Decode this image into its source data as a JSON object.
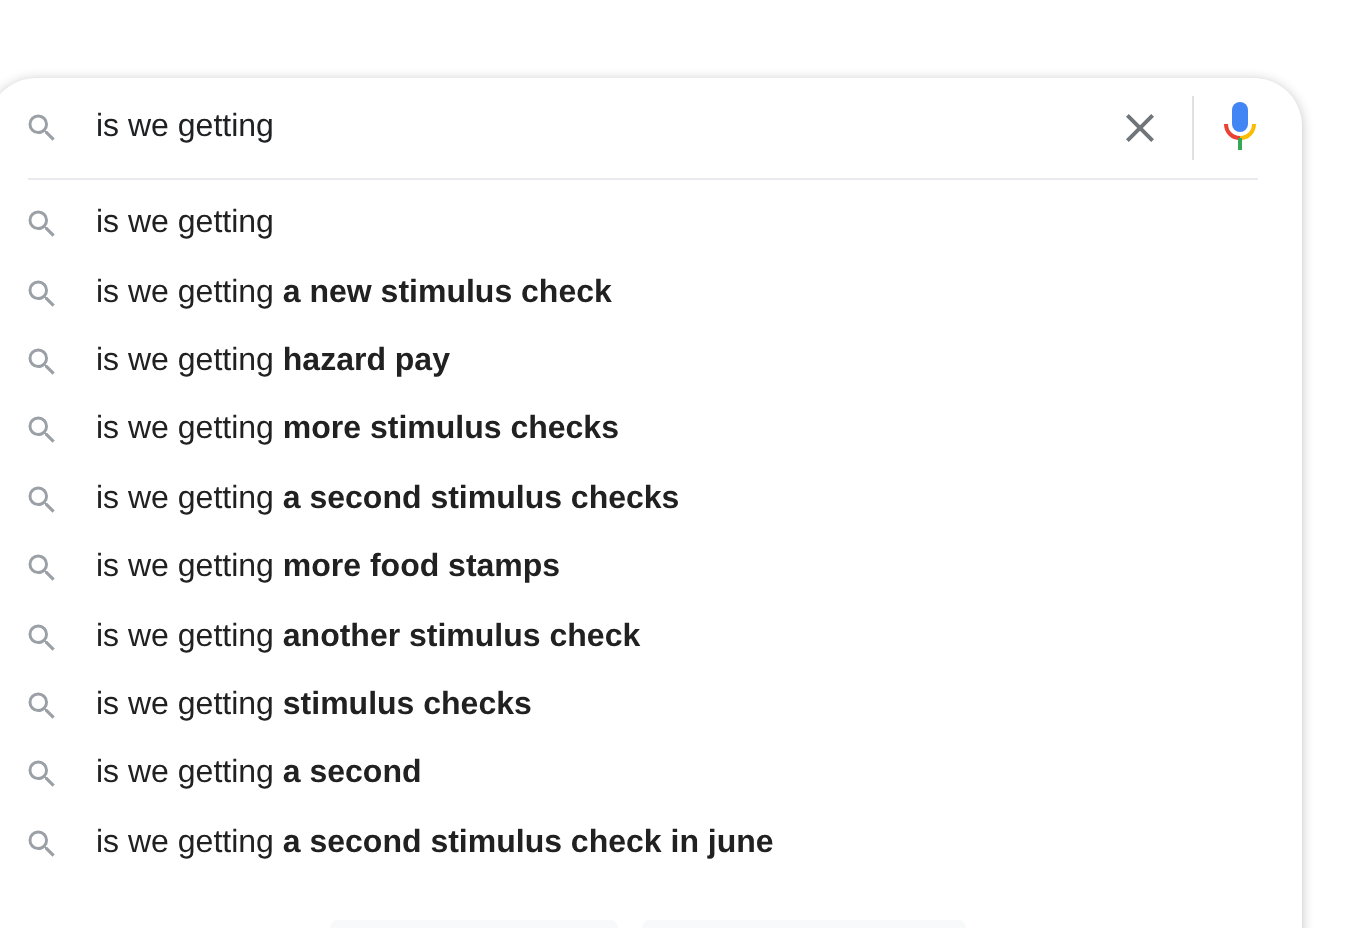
{
  "search": {
    "value": "is we getting"
  },
  "suggestions": [
    {
      "text": "is we getting"
    },
    {
      "text": "is we getting **a new stimulus check**"
    },
    {
      "text": "is we getting **hazard pay**"
    },
    {
      "text": "is we getting **more stimulus checks**"
    },
    {
      "text": "is we getting **a second stimulus checks**"
    },
    {
      "text": "is we getting **more food stamps**"
    },
    {
      "text": "is we getting **another stimulus check**"
    },
    {
      "text": "is we getting **stimulus checks**"
    },
    {
      "text": "is we getting **a second**"
    },
    {
      "text": "is we getting **a second stimulus check in june**"
    }
  ]
}
